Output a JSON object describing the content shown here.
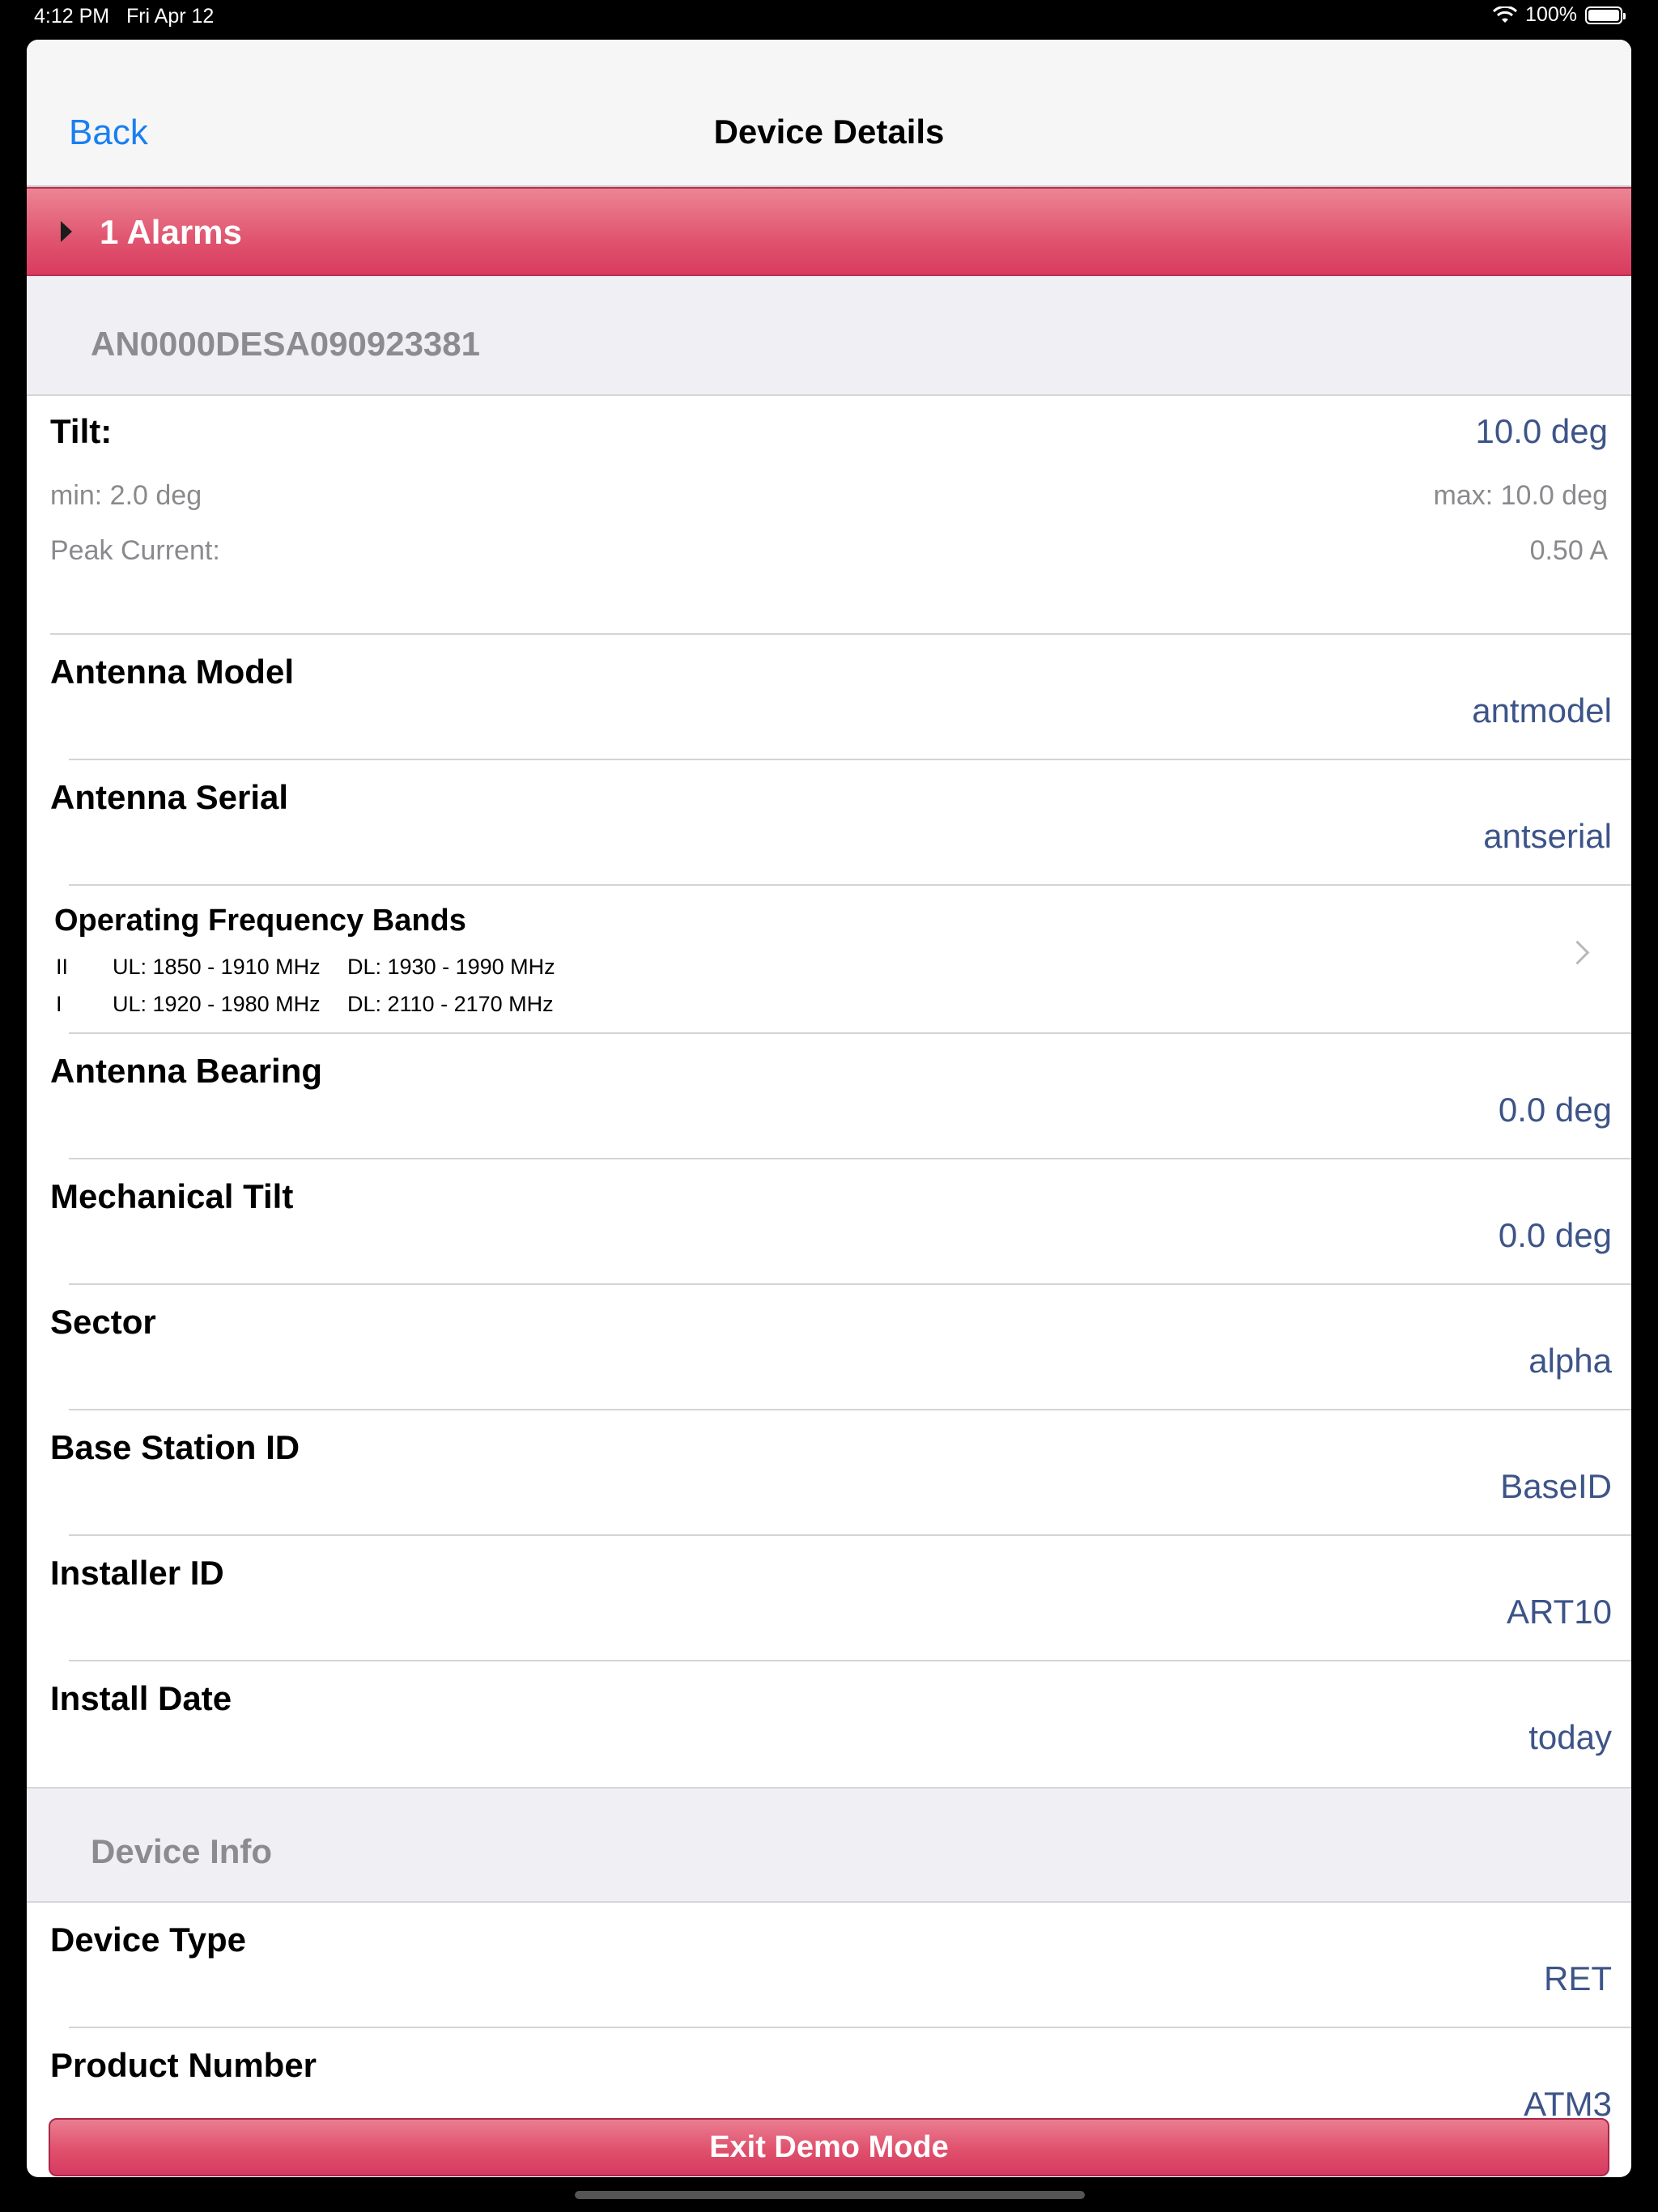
{
  "status_bar": {
    "time": "4:12 PM",
    "date": "Fri Apr 12",
    "battery": "100%",
    "battery_level": 1.0,
    "wifi_icon": "wifi-icon",
    "battery_icon": "battery-icon"
  },
  "nav": {
    "back_label": "Back",
    "title": "Device Details"
  },
  "alarm_bar": {
    "label": "1 Alarms",
    "icon": "disclosure-triangle-icon"
  },
  "device_section": {
    "header": "AN0000DESA090923381"
  },
  "tilt": {
    "label": "Tilt:",
    "value": "10.0 deg",
    "min": "min: 2.0 deg",
    "max": "max: 10.0 deg",
    "peak_label": "Peak Current:",
    "peak_value": "0.50 A"
  },
  "rows": [
    {
      "label": "Antenna Model",
      "value": "antmodel"
    },
    {
      "label": "Antenna Serial",
      "value": "antserial"
    }
  ],
  "frequency": {
    "title": "Operating Frequency Bands",
    "bands": [
      {
        "band": "II",
        "ul": "UL: 1850 - 1910 MHz",
        "dl": "DL: 1930 - 1990 MHz"
      },
      {
        "band": "I",
        "ul": "UL: 1920 - 1980 MHz",
        "dl": "DL: 2110 - 2170 MHz"
      }
    ],
    "chevron_icon": "chevron-right-icon"
  },
  "rows2": [
    {
      "label": "Antenna Bearing",
      "value": "0.0 deg"
    },
    {
      "label": "Mechanical Tilt",
      "value": "0.0 deg"
    },
    {
      "label": "Sector",
      "value": "alpha"
    },
    {
      "label": "Base Station ID",
      "value": "BaseID"
    },
    {
      "label": "Installer ID",
      "value": "ART10"
    },
    {
      "label": "Install Date",
      "value": "today"
    }
  ],
  "device_info": {
    "header": "Device Info",
    "rows": [
      {
        "label": "Device Type",
        "value": "RET"
      },
      {
        "label": "Product Number",
        "value": "ATM3"
      }
    ]
  },
  "exit_button": {
    "label": "Exit Demo Mode"
  },
  "colors": {
    "accent": "#1a7ff0",
    "alarm": "#e0546f",
    "value_text": "#3d5488",
    "section_bg": "#efeff4"
  }
}
